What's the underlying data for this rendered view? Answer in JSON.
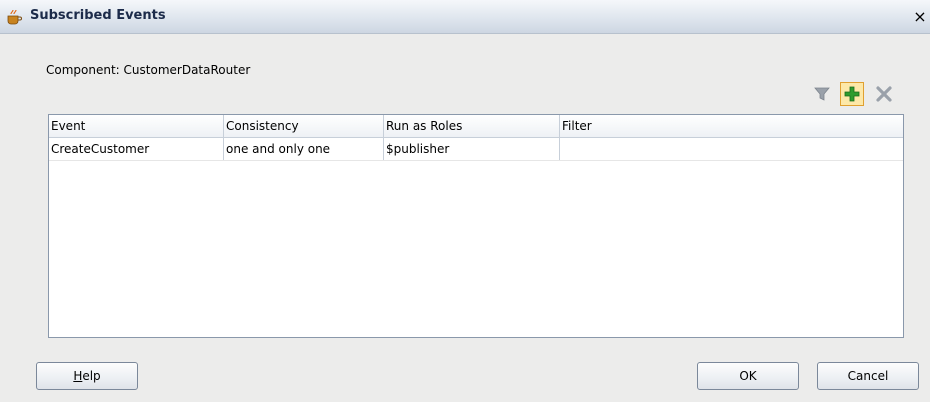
{
  "window": {
    "title": "Subscribed Events",
    "close_glyph": "×"
  },
  "component": {
    "label": "Component:",
    "value": "CustomerDataRouter"
  },
  "toolbar": {
    "filter_icon": "filter-icon",
    "add_icon": "add-icon",
    "delete_icon": "delete-icon"
  },
  "table": {
    "columns": [
      "Event",
      "Consistency",
      "Run as Roles",
      "Filter"
    ],
    "rows": [
      {
        "event": "CreateCustomer",
        "consistency": "one and only one",
        "run_as_roles": "$publisher",
        "filter": ""
      }
    ]
  },
  "buttons": {
    "help_mnemonic": "H",
    "help_rest": "elp",
    "ok": "OK",
    "cancel": "Cancel"
  },
  "colors": {
    "accent": "#f4b400",
    "add_green": "#2e9b2e",
    "selected_border": "#e0a030"
  }
}
